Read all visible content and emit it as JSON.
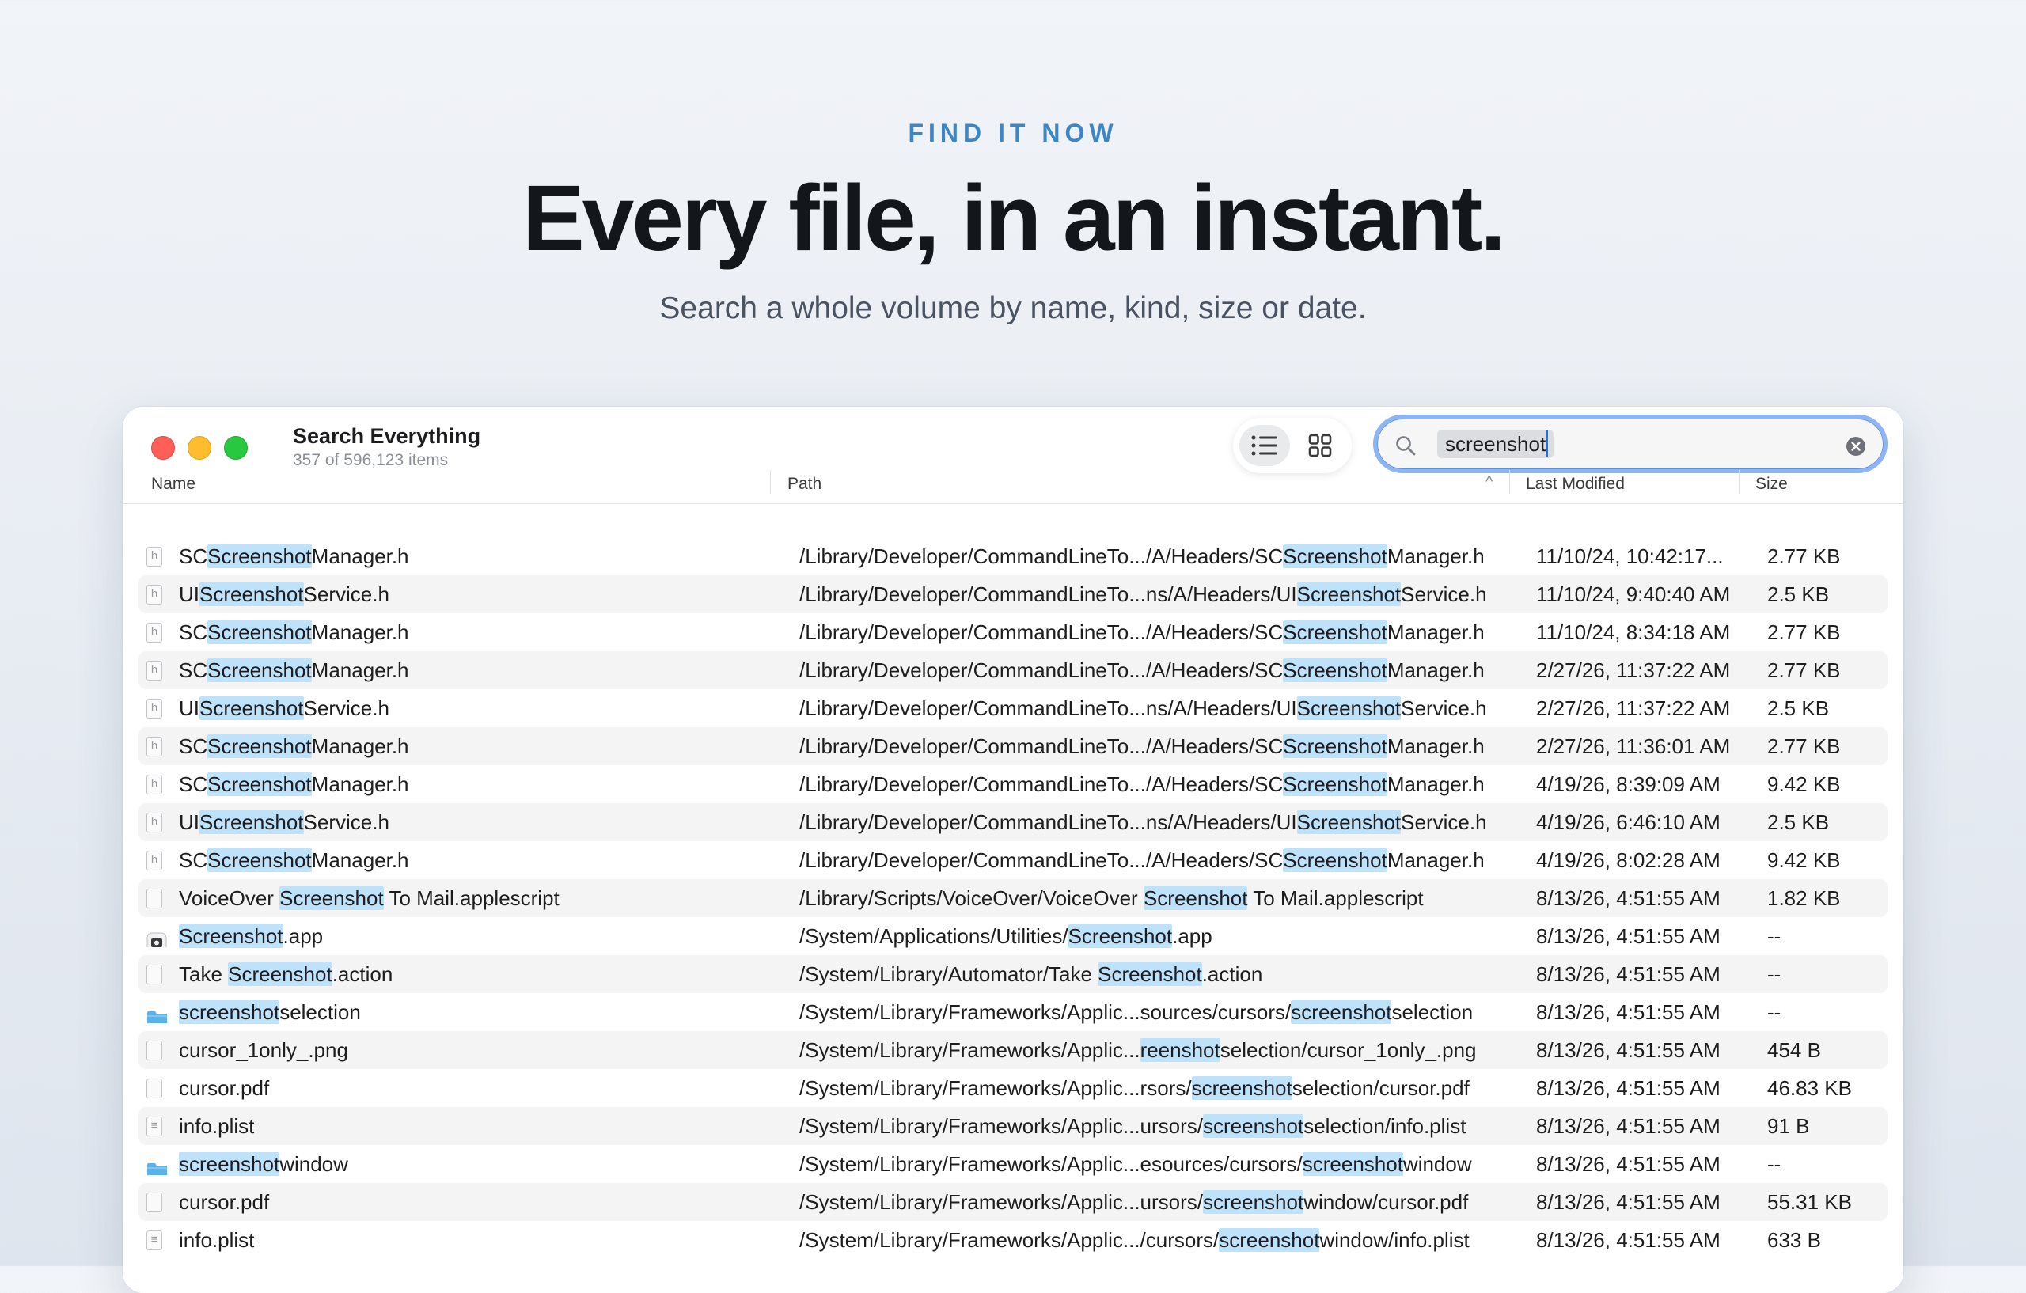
{
  "hero": {
    "eyebrow": "FIND IT NOW",
    "headline": "Every file, in an instant.",
    "subhead": "Search a whole volume by name, kind, size or date."
  },
  "window": {
    "title": "Search Everything",
    "subtitle": "357 of 596,123 items",
    "search": {
      "value": "screenshot"
    },
    "view_modes": [
      "list",
      "grid"
    ],
    "active_view": "list"
  },
  "columns": {
    "name": "Name",
    "path": "Path",
    "modified": "Last Modified",
    "size": "Size"
  },
  "colors": {
    "highlight": "#bfe2fb",
    "accent": "#3d86c6",
    "folder": "#5bb2ea",
    "search_ring": "#8db5f4"
  },
  "rows": [
    {
      "icon": "header-file-icon",
      "name": [
        "SC",
        "Screenshot",
        "Manager.h"
      ],
      "path": [
        "/Library/Developer/CommandLineTo.../A/Headers/SC",
        "Screenshot",
        "Manager.h"
      ],
      "modified": "11/10/24, 10:42:17...",
      "size": "2.77 KB"
    },
    {
      "icon": "header-file-icon",
      "name": [
        "UI",
        "Screenshot",
        "Service.h"
      ],
      "path": [
        "/Library/Developer/CommandLineTo...ns/A/Headers/UI",
        "Screenshot",
        "Service.h"
      ],
      "modified": "11/10/24, 9:40:40 AM",
      "size": "2.5 KB"
    },
    {
      "icon": "header-file-icon",
      "name": [
        "SC",
        "Screenshot",
        "Manager.h"
      ],
      "path": [
        "/Library/Developer/CommandLineTo.../A/Headers/SC",
        "Screenshot",
        "Manager.h"
      ],
      "modified": "11/10/24, 8:34:18 AM",
      "size": "2.77 KB"
    },
    {
      "icon": "header-file-icon",
      "name": [
        "SC",
        "Screenshot",
        "Manager.h"
      ],
      "path": [
        "/Library/Developer/CommandLineTo.../A/Headers/SC",
        "Screenshot",
        "Manager.h"
      ],
      "modified": "2/27/26, 11:37:22 AM",
      "size": "2.77 KB"
    },
    {
      "icon": "header-file-icon",
      "name": [
        "UI",
        "Screenshot",
        "Service.h"
      ],
      "path": [
        "/Library/Developer/CommandLineTo...ns/A/Headers/UI",
        "Screenshot",
        "Service.h"
      ],
      "modified": "2/27/26, 11:37:22 AM",
      "size": "2.5 KB"
    },
    {
      "icon": "header-file-icon",
      "name": [
        "SC",
        "Screenshot",
        "Manager.h"
      ],
      "path": [
        "/Library/Developer/CommandLineTo.../A/Headers/SC",
        "Screenshot",
        "Manager.h"
      ],
      "modified": "2/27/26, 11:36:01 AM",
      "size": "2.77 KB"
    },
    {
      "icon": "header-file-icon",
      "name": [
        "SC",
        "Screenshot",
        "Manager.h"
      ],
      "path": [
        "/Library/Developer/CommandLineTo.../A/Headers/SC",
        "Screenshot",
        "Manager.h"
      ],
      "modified": "4/19/26, 8:39:09 AM",
      "size": "9.42 KB"
    },
    {
      "icon": "header-file-icon",
      "name": [
        "UI",
        "Screenshot",
        "Service.h"
      ],
      "path": [
        "/Library/Developer/CommandLineTo...ns/A/Headers/UI",
        "Screenshot",
        "Service.h"
      ],
      "modified": "4/19/26, 6:46:10 AM",
      "size": "2.5 KB"
    },
    {
      "icon": "header-file-icon",
      "name": [
        "SC",
        "Screenshot",
        "Manager.h"
      ],
      "path": [
        "/Library/Developer/CommandLineTo.../A/Headers/SC",
        "Screenshot",
        "Manager.h"
      ],
      "modified": "4/19/26, 8:02:28 AM",
      "size": "9.42 KB"
    },
    {
      "icon": "script-file-icon",
      "name": [
        "VoiceOver ",
        "Screenshot",
        " To Mail.applescript"
      ],
      "path": [
        "/Library/Scripts/VoiceOver/VoiceOver ",
        "Screenshot",
        " To Mail.applescript"
      ],
      "modified": "8/13/26, 4:51:55 AM",
      "size": "1.82 KB"
    },
    {
      "icon": "screenshot-app-icon",
      "name": [
        "",
        "Screenshot",
        ".app"
      ],
      "path": [
        "/System/Applications/Utilities/",
        "Screenshot",
        ".app"
      ],
      "modified": "8/13/26, 4:51:55 AM",
      "size": "--"
    },
    {
      "icon": "automator-action-icon",
      "name": [
        "Take ",
        "Screenshot",
        ".action"
      ],
      "path": [
        "/System/Library/Automator/Take ",
        "Screenshot",
        ".action"
      ],
      "modified": "8/13/26, 4:51:55 AM",
      "size": "--"
    },
    {
      "icon": "folder-icon",
      "name": [
        "",
        "screenshot",
        "selection"
      ],
      "path": [
        "/System/Library/Frameworks/Applic...sources/cursors/",
        "screenshot",
        "selection"
      ],
      "modified": "8/13/26, 4:51:55 AM",
      "size": "--"
    },
    {
      "icon": "image-file-icon",
      "name": [
        "cursor_1only_.png",
        "",
        ""
      ],
      "path": [
        "/System/Library/Frameworks/Applic...",
        "reenshot",
        "selection/cursor_1only_.png"
      ],
      "modified": "8/13/26, 4:51:55 AM",
      "size": "454 B"
    },
    {
      "icon": "pdf-file-icon",
      "name": [
        "cursor.pdf",
        "",
        ""
      ],
      "path": [
        "/System/Library/Frameworks/Applic...rsors/",
        "screenshot",
        "selection/cursor.pdf"
      ],
      "modified": "8/13/26, 4:51:55 AM",
      "size": "46.83 KB"
    },
    {
      "icon": "plist-file-icon",
      "name": [
        "info.plist",
        "",
        ""
      ],
      "path": [
        "/System/Library/Frameworks/Applic...ursors/",
        "screenshot",
        "selection/info.plist"
      ],
      "modified": "8/13/26, 4:51:55 AM",
      "size": "91 B"
    },
    {
      "icon": "folder-icon",
      "name": [
        "",
        "screenshot",
        "window"
      ],
      "path": [
        "/System/Library/Frameworks/Applic...esources/cursors/",
        "screenshot",
        "window"
      ],
      "modified": "8/13/26, 4:51:55 AM",
      "size": "--"
    },
    {
      "icon": "pdf-file-icon",
      "name": [
        "cursor.pdf",
        "",
        ""
      ],
      "path": [
        "/System/Library/Frameworks/Applic...ursors/",
        "screenshot",
        "window/cursor.pdf"
      ],
      "modified": "8/13/26, 4:51:55 AM",
      "size": "55.31 KB"
    },
    {
      "icon": "plist-file-icon",
      "name": [
        "info.plist",
        "",
        ""
      ],
      "path": [
        "/System/Library/Frameworks/Applic.../cursors/",
        "screenshot",
        "window/info.plist"
      ],
      "modified": "8/13/26, 4:51:55 AM",
      "size": "633 B"
    }
  ]
}
